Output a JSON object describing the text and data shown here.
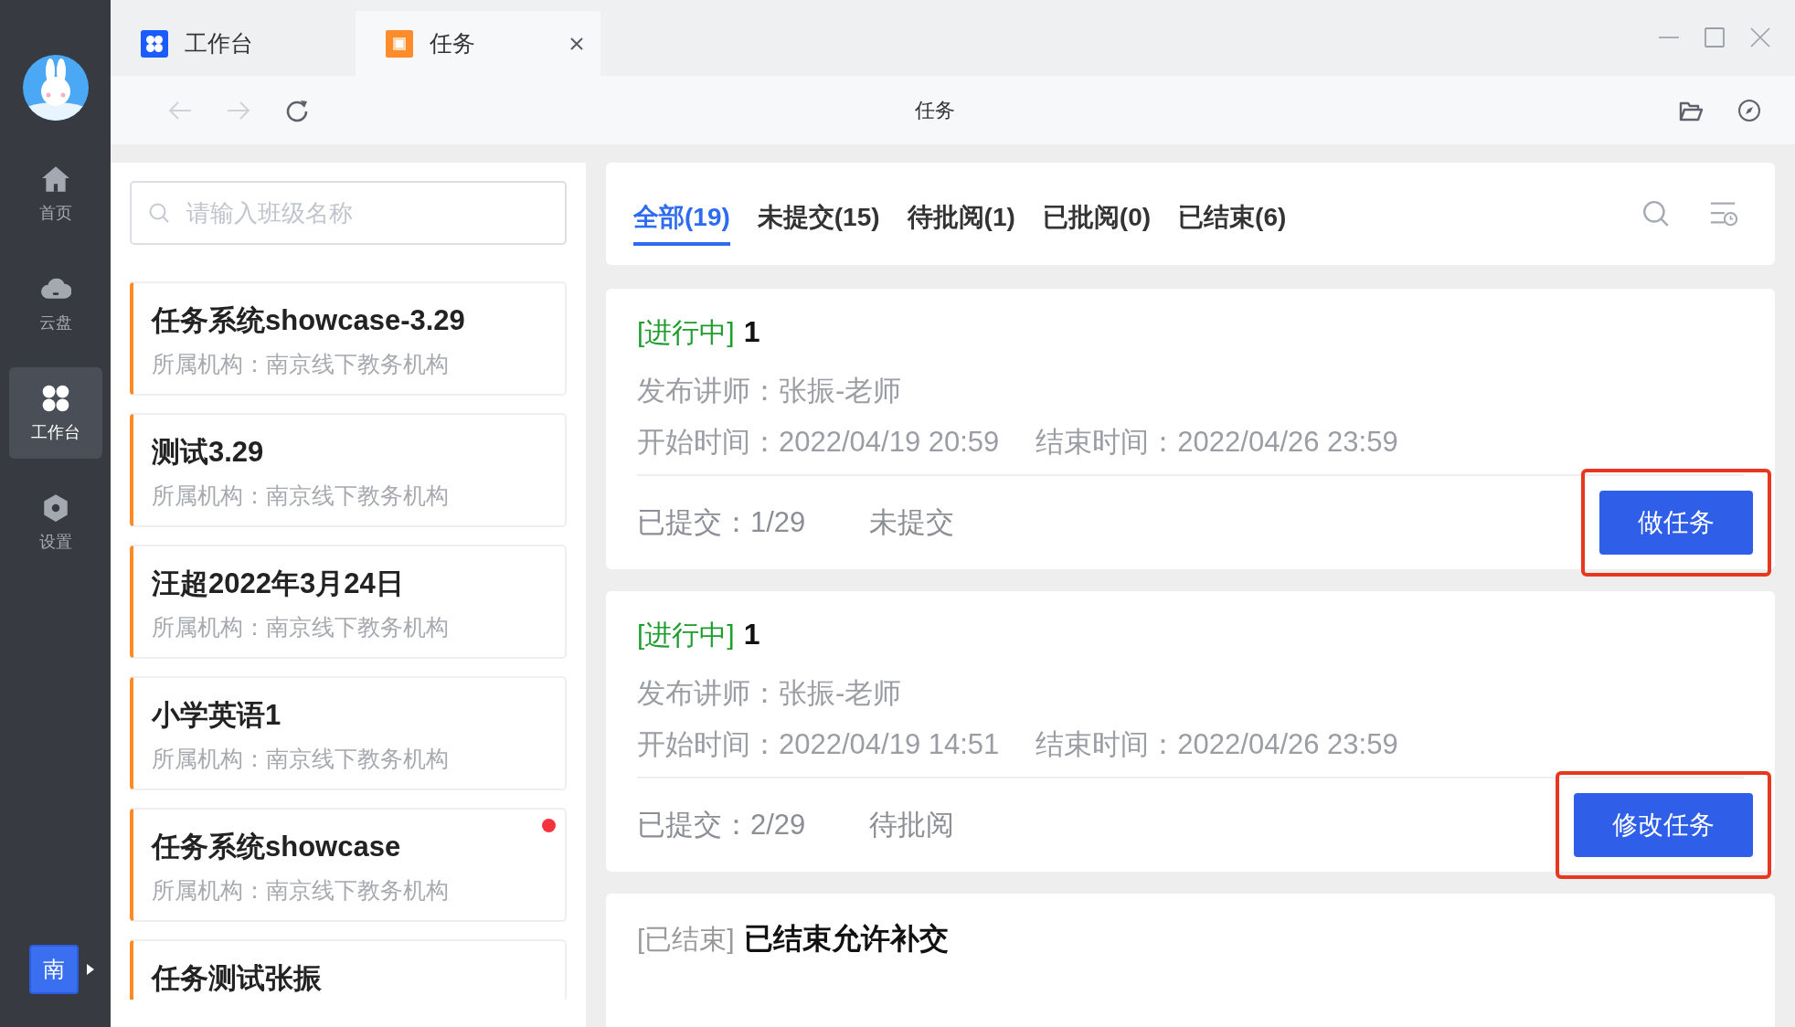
{
  "nav": {
    "items": [
      {
        "label": "首页",
        "kind": "home",
        "selected": false
      },
      {
        "label": "云盘",
        "kind": "cloud",
        "selected": false
      },
      {
        "label": "工作台",
        "kind": "workbench",
        "selected": true
      },
      {
        "label": "设置",
        "kind": "settings",
        "selected": false
      }
    ],
    "org_badge": "南"
  },
  "tabs": [
    {
      "label": "工作台",
      "kind": "workbench",
      "selected": false
    },
    {
      "label": "任务",
      "kind": "task",
      "selected": true
    }
  ],
  "toolbar": {
    "title": "任务"
  },
  "class_search": {
    "placeholder": "请输入班级名称"
  },
  "classes": [
    {
      "name": "任务系统showcase-3.29",
      "org": "所属机构：南京线下教务机构",
      "unread": false
    },
    {
      "name": "测试3.29",
      "org": "所属机构：南京线下教务机构",
      "unread": false
    },
    {
      "name": "汪超2022年3月24日",
      "org": "所属机构：南京线下教务机构",
      "unread": false
    },
    {
      "name": "小学英语1",
      "org": "所属机构：南京线下教务机构",
      "unread": false
    },
    {
      "name": "任务系统showcase",
      "org": "所属机构：南京线下教务机构",
      "unread": true
    },
    {
      "name": "任务测试张振",
      "unread": false
    }
  ],
  "filters": [
    {
      "label": "全部(19)",
      "selected": true
    },
    {
      "label": "未提交(15)",
      "selected": false
    },
    {
      "label": "待批阅(1)",
      "selected": false
    },
    {
      "label": "已批阅(0)",
      "selected": false
    },
    {
      "label": "已结束(6)",
      "selected": false
    }
  ],
  "tasks": [
    {
      "status": "[进行中]",
      "color": "#1f9d2f",
      "title": "1",
      "teacher": "发布讲师：张振-老师",
      "start": "开始时间：2022/04/19 20:59",
      "end": "结束时间：2022/04/26 23:59",
      "submitted": "已提交：1/29",
      "state": "未提交",
      "action": "做任务",
      "highlighted": true
    },
    {
      "status": "[进行中]",
      "color": "#1f9d2f",
      "title": "1",
      "teacher": "发布讲师：张振-老师",
      "start": "开始时间：2022/04/19 14:51",
      "end": "结束时间：2022/04/26 23:59",
      "submitted": "已提交：2/29",
      "state": "待批阅",
      "action": "修改任务",
      "highlighted": true
    },
    {
      "status": "[已结束]",
      "color": "#999999",
      "title": "已结束允许补交"
    }
  ]
}
